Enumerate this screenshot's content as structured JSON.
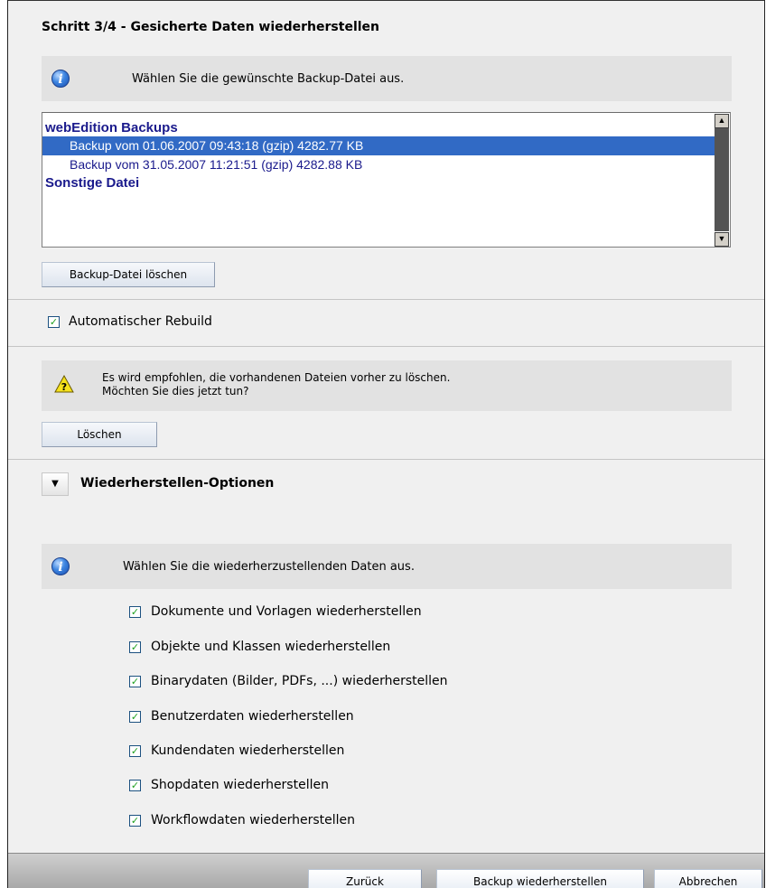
{
  "title": "Schritt 3/4 - Gesicherte Daten wiederherstellen",
  "info_select": "Wählen Sie die gewünschte Backup-Datei aus.",
  "backup_list": {
    "group1": "webEdition Backups",
    "items": [
      "Backup vom 01.06.2007 09:43:18 (gzip) 4282.77 KB",
      "Backup vom 31.05.2007 11:21:51 (gzip) 4282.88 KB"
    ],
    "group2": "Sonstige Datei"
  },
  "delete_backup_label": "Backup-Datei löschen",
  "auto_rebuild_label": "Automatischer Rebuild",
  "warning_line1": "Es wird empfohlen, die vorhandenen Dateien vorher zu löschen.",
  "warning_line2": "Möchten Sie dies jetzt tun?",
  "delete_label": "Löschen",
  "section_title": "Wiederherstellen-Optionen",
  "info_data": "Wählen Sie die wiederherzustellenden Daten aus.",
  "options": [
    "Dokumente und Vorlagen wiederherstellen",
    "Objekte und Klassen wiederherstellen",
    "Binarydaten (Bilder, PDFs, ...) wiederherstellen",
    "Benutzerdaten wiederherstellen",
    "Kundendaten wiederherstellen",
    "Shopdaten wiederherstellen",
    "Workflowdaten wiederherstellen"
  ],
  "footer": {
    "back": "Zurück",
    "restore": "Backup wiederherstellen",
    "cancel": "Abbrechen"
  },
  "colors": {
    "selection": "#316ac5",
    "check": "#21a121",
    "list_text": "#1a1a8c"
  }
}
